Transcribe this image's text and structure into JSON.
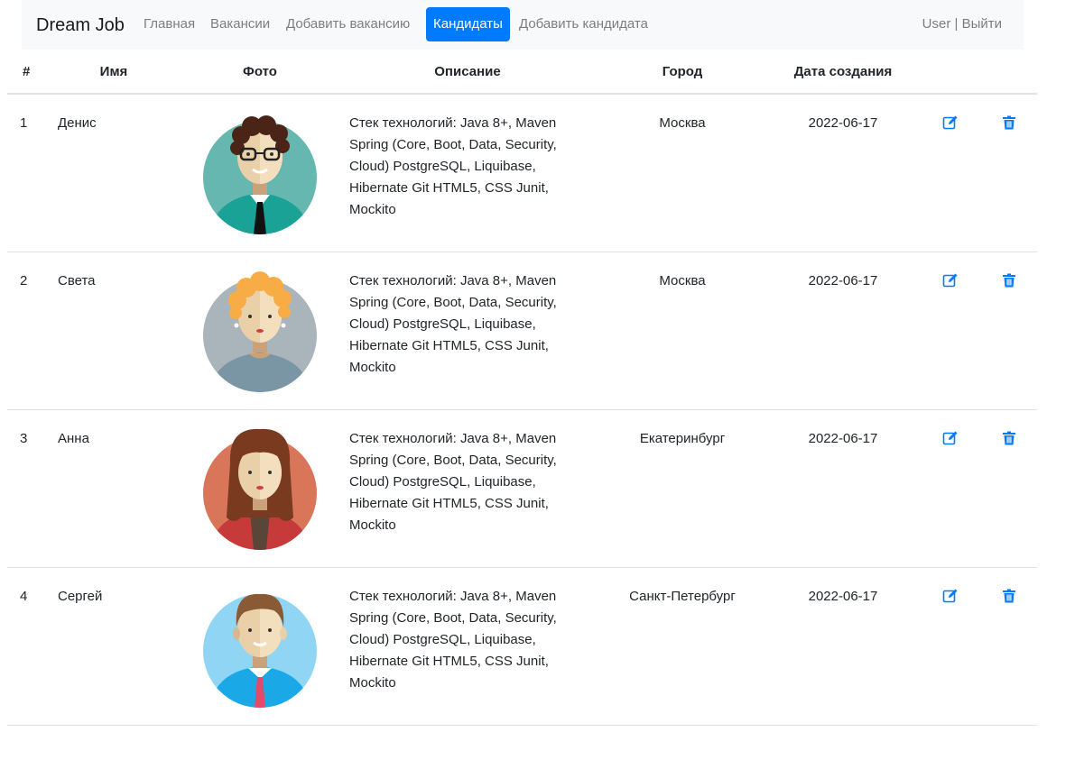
{
  "navbar": {
    "brand": "Dream Job",
    "links": [
      "Главная",
      "Вакансии",
      "Добавить вакансию",
      "Кандидаты",
      "Добавить кандидата"
    ],
    "active": "Кандидаты",
    "user": "User | Выйти",
    "bg_color": "#f8f9fa",
    "active_color": "#007bff"
  },
  "table": {
    "headers": [
      "#",
      "Имя",
      "Фото",
      "Описание",
      "Город",
      "Дата создания"
    ],
    "rows": [
      {
        "num": "1",
        "name": "Денис",
        "avatar": "man-curly-hair-glasses",
        "desc": "Стек технологий: Java 8+, Maven Spring (Core, Boot, Data, Security, Cloud) PostgreSQL, Liquibase, Hibernate Git HTML5, CSS Junit, Mockito",
        "city": "Москва",
        "date": "2022-06-17"
      },
      {
        "num": "2",
        "name": "Света",
        "avatar": "woman-curly-blonde",
        "desc": "Стек технологий: Java 8+, Maven Spring (Core, Boot, Data, Security, Cloud) PostgreSQL, Liquibase, Hibernate Git HTML5, CSS Junit, Mockito",
        "city": "Москва",
        "date": "2022-06-17"
      },
      {
        "num": "3",
        "name": "Анна",
        "avatar": "woman-long-brown-hair",
        "desc": "Стек технологий: Java 8+, Maven Spring (Core, Boot, Data, Security, Cloud) PostgreSQL, Liquibase, Hibernate Git HTML5, CSS Junit, Mockito",
        "city": "Екатеринбург",
        "date": "2022-06-17"
      },
      {
        "num": "4",
        "name": "Сергей",
        "avatar": "man-brown-hair",
        "desc": "Стек технологий: Java 8+, Maven Spring (Core, Boot, Data, Security, Cloud) PostgreSQL, Liquibase, Hibernate Git HTML5, CSS Junit, Mockito",
        "city": "Санкт-Петербург",
        "date": "2022-06-17"
      }
    ],
    "row_icons": [
      "edit-icon",
      "trash-icon"
    ],
    "icon_color": "#007bff"
  }
}
